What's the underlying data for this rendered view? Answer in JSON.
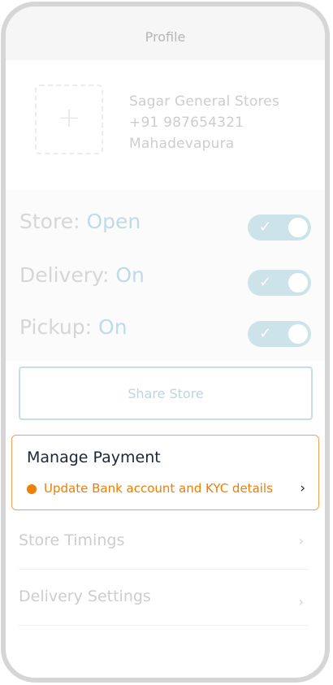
{
  "header": {
    "title": "Profile"
  },
  "store": {
    "name": "Sagar General Stores",
    "phone": "+91 987654321",
    "location": "Mahadevapura",
    "photo_placeholder": "+"
  },
  "toggles": [
    {
      "label": "Store:",
      "value": "Open",
      "enabled": true
    },
    {
      "label": "Delivery:",
      "value": "On",
      "enabled": true
    },
    {
      "label": "Pickup:",
      "value": "On",
      "enabled": true
    }
  ],
  "share_button": {
    "label": "Share Store"
  },
  "payment": {
    "title": "Manage Payment",
    "subtitle": "Update Bank account and KYC details",
    "chevron": "›"
  },
  "menu": [
    {
      "label": "Store Timings",
      "chevron": "›"
    },
    {
      "label": "Delivery Settings",
      "chevron": "›"
    }
  ],
  "colors": {
    "accent_orange": "#ef7d00",
    "toggle_blue": "#cde3ea",
    "share_border": "#c3e0ea"
  }
}
